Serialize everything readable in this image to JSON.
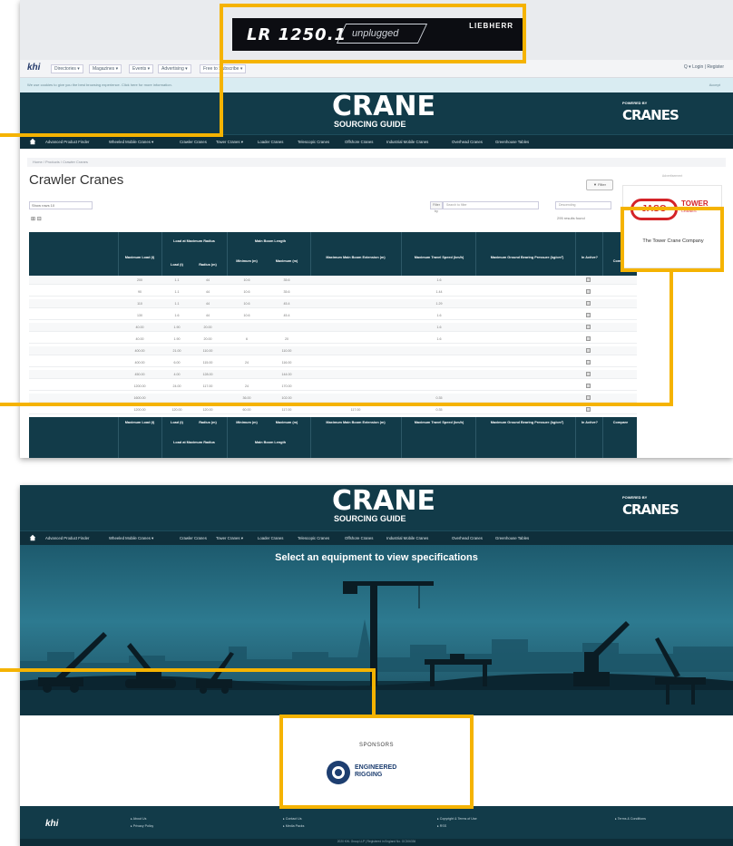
{
  "shot1": {
    "ad_banner": {
      "model": "LR 1250.1",
      "suffix": "unplugged",
      "brand": "LIEBHERR"
    },
    "nav": {
      "logo": "khi",
      "items": [
        "Directories ▾",
        "Magazines ▾",
        "Events ▾",
        "Advertising ▾",
        "Free to Subscribe ▾"
      ],
      "right": "Q ▾   Login | Register"
    },
    "info_bar": {
      "text": "We use cookies to give you the best browsing experience. Click here for more information.",
      "button": "Accept"
    },
    "header": {
      "title": "CRANE",
      "subtitle": "SOURCING GUIDE",
      "powered_by": "POWERED BY",
      "partner_logo": "CRANES",
      "partner_top": "INTERNATIONAL",
      "partner_bottom": "AND SPECIALIZED TRANSPORT"
    },
    "menu": [
      "Advanced Product Finder",
      "Wheeled Mobile Cranes ▾",
      "Crawler Cranes",
      "Tower Cranes ▾",
      "Loader Cranes",
      "Telescopic Cranes",
      "Offshore Cranes",
      "Industrial Mobile Cranes",
      "Overhead Cranes",
      "Greenhouse Tables"
    ],
    "breadcrumb": "Home  /  Products  /  Crawler Cranes",
    "page_title": "Crawler Cranes",
    "show_select": "Show rows  10",
    "icons_row": "⊞  ⊟",
    "filter_button": "▼ Filter",
    "search_label": "Filter by",
    "search_placeholder": "Search to filter",
    "sort_placeholder": "Descending",
    "results": "295 results found",
    "table": {
      "load_at_max_radius": "Load at Maximum Radius",
      "main_boom_length": "Main Boom Length",
      "columns": [
        "Maximum Load (t)",
        "Load (t)",
        "Radius (m)",
        "Minimum (m)",
        "Maximum (m)",
        "Maximum Main Boom Extension (m)",
        "Maximum Travel Speed (km/h)",
        "Maximum Ground Bearing Pressure (kg/cm²)",
        "In Active?",
        "Compare"
      ],
      "rows": [
        [
          "200",
          "1.1",
          "44",
          "10.6",
          "35.6",
          "",
          "1.6"
        ],
        [
          "90",
          "1.1",
          "44",
          "10.6",
          "35.6",
          "",
          "1.44"
        ],
        [
          "110",
          "1.1",
          "44",
          "10.6",
          "45.4",
          "",
          "1.29"
        ],
        [
          "130",
          "1.6",
          "44",
          "10.6",
          "45.4",
          "",
          "1.6"
        ],
        [
          "40.00",
          "1.90",
          "20.00",
          "",
          "",
          "",
          "1.6"
        ],
        [
          "40.00",
          "1.90",
          "20.00",
          "6",
          "20",
          "",
          "1.6"
        ],
        [
          "400.00",
          "21.00",
          "110.00",
          "",
          "110.00",
          "",
          ""
        ],
        [
          "400.00",
          "6.00",
          "115.00",
          "24",
          "116.00",
          "",
          ""
        ],
        [
          "450.00",
          "4.00",
          "128.00",
          "",
          "144.00",
          "",
          ""
        ],
        [
          "1200.00",
          "24.00",
          "117.00",
          "24",
          "170.00",
          "",
          ""
        ],
        [
          "1600.00",
          "",
          "",
          "36.00",
          "102.00",
          "",
          "0.35"
        ],
        [
          "1200.00",
          "120.00",
          "120.00",
          "60.00",
          "117.00",
          "117.00",
          "0.35"
        ]
      ]
    },
    "side_ad": {
      "top": "Advertisement",
      "logo": "JASO",
      "tower": "TOWER",
      "cranes": "CRANES",
      "caption": "The Tower Crane Company"
    }
  },
  "shot2": {
    "header": {
      "title": "CRANE",
      "subtitle": "SOURCING GUIDE",
      "powered_by": "POWERED BY",
      "partner_logo": "CRANES"
    },
    "menu": [
      "Advanced Product Finder",
      "Wheeled Mobile Cranes ▾",
      "Crawler Cranes",
      "Tower Cranes ▾",
      "Loader Cranes",
      "Telescopic Cranes",
      "Offshore Cranes",
      "Industrial Mobile Cranes",
      "Overhead Cranes",
      "Greenhouse Tables"
    ],
    "hero_title": "Select an equipment to view specifications",
    "sponsors_label": "SPONSORS",
    "sponsor": {
      "line1": "ENGINEERED",
      "line2": "RIGGING"
    },
    "footer": {
      "logo": "khi",
      "links": [
        "▸ About Us",
        "▸ Privacy Policy",
        "▸ Contact Us",
        "▸ Media Packs",
        "▸ Copyright & Terms of Use",
        "▸ RSS",
        "▸ Terms & Conditions"
      ],
      "copyright": "2020 KHL Group LLP | Registered in England No. OC306336"
    }
  },
  "colors": {
    "highlight": "#f5b301",
    "header": "#123b49",
    "menu": "#0f2f3b",
    "active_tab": "#2e8fb0",
    "jaso_red": "#d42328",
    "rigging_blue": "#1d3e70"
  }
}
